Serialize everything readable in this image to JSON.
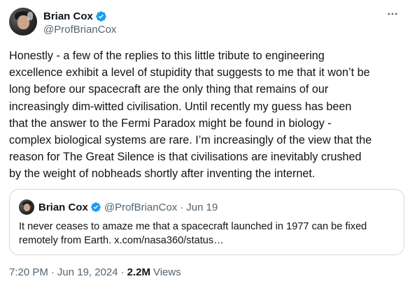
{
  "author": {
    "name": "Brian Cox",
    "handle": "@ProfBrianCox",
    "verified_color": "#1d9bf0"
  },
  "more_icon": "ellipsis-icon",
  "tweet": {
    "text": "Honestly - a few of the replies to this little tribute to engineering\nexcellence exhibit a level of stupidity that suggests to me that it won’t be\nlong before our spacecraft are the only thing that remains of our\nincreasingly dim-witted civilisation. Until recently my guess has been\nthat the answer to the Fermi Paradox might be found in biology -\ncomplex biological systems are rare. I’m increasingly of the view that the\nreason for The Great Silence is that civilisations are inevitably crushed\nby the weight of nobheads shortly after inventing the internet."
  },
  "quote": {
    "name": "Brian Cox",
    "handle": "@ProfBrianCox",
    "separator": "·",
    "date": "Jun 19",
    "text": "It never ceases to amaze me that a spacecraft launched in 1977 can be fixed\nremotely from Earth. x.com/nasa360/status…"
  },
  "meta": {
    "time": "7:20 PM",
    "separator": "·",
    "date": "Jun 19, 2024",
    "separator2": "·",
    "views_count": "2.2M",
    "views_label": "Views"
  }
}
